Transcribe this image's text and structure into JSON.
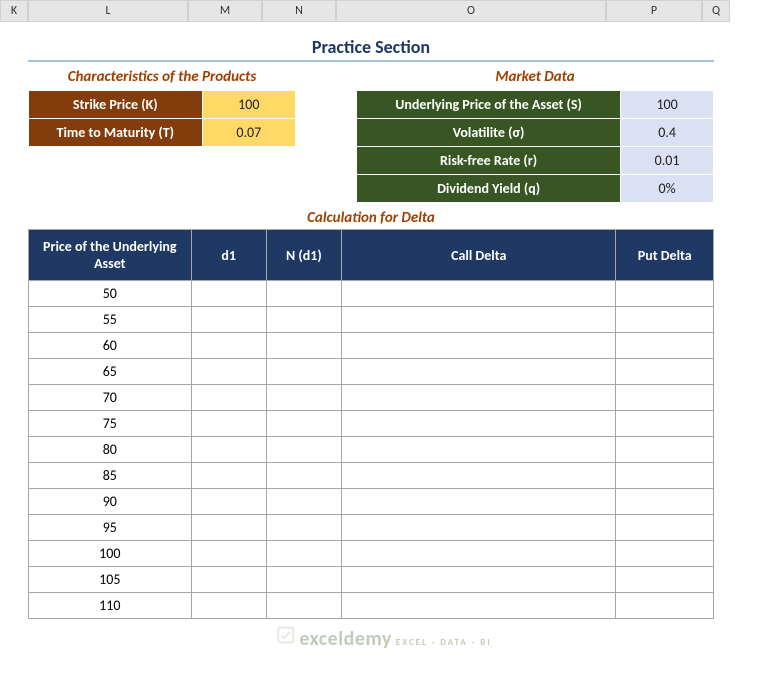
{
  "columns": [
    "K",
    "L",
    "M",
    "N",
    "O",
    "P",
    "Q"
  ],
  "title": "Practice Section",
  "characteristics": {
    "heading": "Characteristics of the Products",
    "rows": [
      {
        "label": "Strike Price (K)",
        "value": "100"
      },
      {
        "label": "Time to Maturity (T)",
        "value": "0.07"
      }
    ]
  },
  "market": {
    "heading": "Market Data",
    "rows": [
      {
        "label": "Underlying Price of the Asset (S)",
        "value": "100"
      },
      {
        "label": "Volatilite (σ)",
        "value": "0.4"
      },
      {
        "label": "Risk-free Rate (r)",
        "value": "0.01"
      },
      {
        "label": "Dividend Yield (q)",
        "value": "0%"
      }
    ]
  },
  "calc_heading": "Calculation for Delta",
  "delta_headers": [
    "Price of the Underlying Asset",
    "d1",
    "N (d1)",
    "Call Delta",
    "Put Delta"
  ],
  "delta_rows": [
    {
      "price": "50"
    },
    {
      "price": "55"
    },
    {
      "price": "60"
    },
    {
      "price": "65"
    },
    {
      "price": "70"
    },
    {
      "price": "75"
    },
    {
      "price": "80"
    },
    {
      "price": "85"
    },
    {
      "price": "90"
    },
    {
      "price": "95"
    },
    {
      "price": "100"
    },
    {
      "price": "105"
    },
    {
      "price": "110"
    }
  ],
  "watermark": {
    "brand": "exceldemy",
    "tag": "EXCEL · DATA · BI"
  },
  "chart_data": {
    "type": "table",
    "title": "Calculation for Delta",
    "columns": [
      "Price of the Underlying Asset",
      "d1",
      "N (d1)",
      "Call Delta",
      "Put Delta"
    ],
    "rows": [
      [
        50,
        null,
        null,
        null,
        null
      ],
      [
        55,
        null,
        null,
        null,
        null
      ],
      [
        60,
        null,
        null,
        null,
        null
      ],
      [
        65,
        null,
        null,
        null,
        null
      ],
      [
        70,
        null,
        null,
        null,
        null
      ],
      [
        75,
        null,
        null,
        null,
        null
      ],
      [
        80,
        null,
        null,
        null,
        null
      ],
      [
        85,
        null,
        null,
        null,
        null
      ],
      [
        90,
        null,
        null,
        null,
        null
      ],
      [
        95,
        null,
        null,
        null,
        null
      ],
      [
        100,
        null,
        null,
        null,
        null
      ],
      [
        105,
        null,
        null,
        null,
        null
      ],
      [
        110,
        null,
        null,
        null,
        null
      ]
    ]
  }
}
